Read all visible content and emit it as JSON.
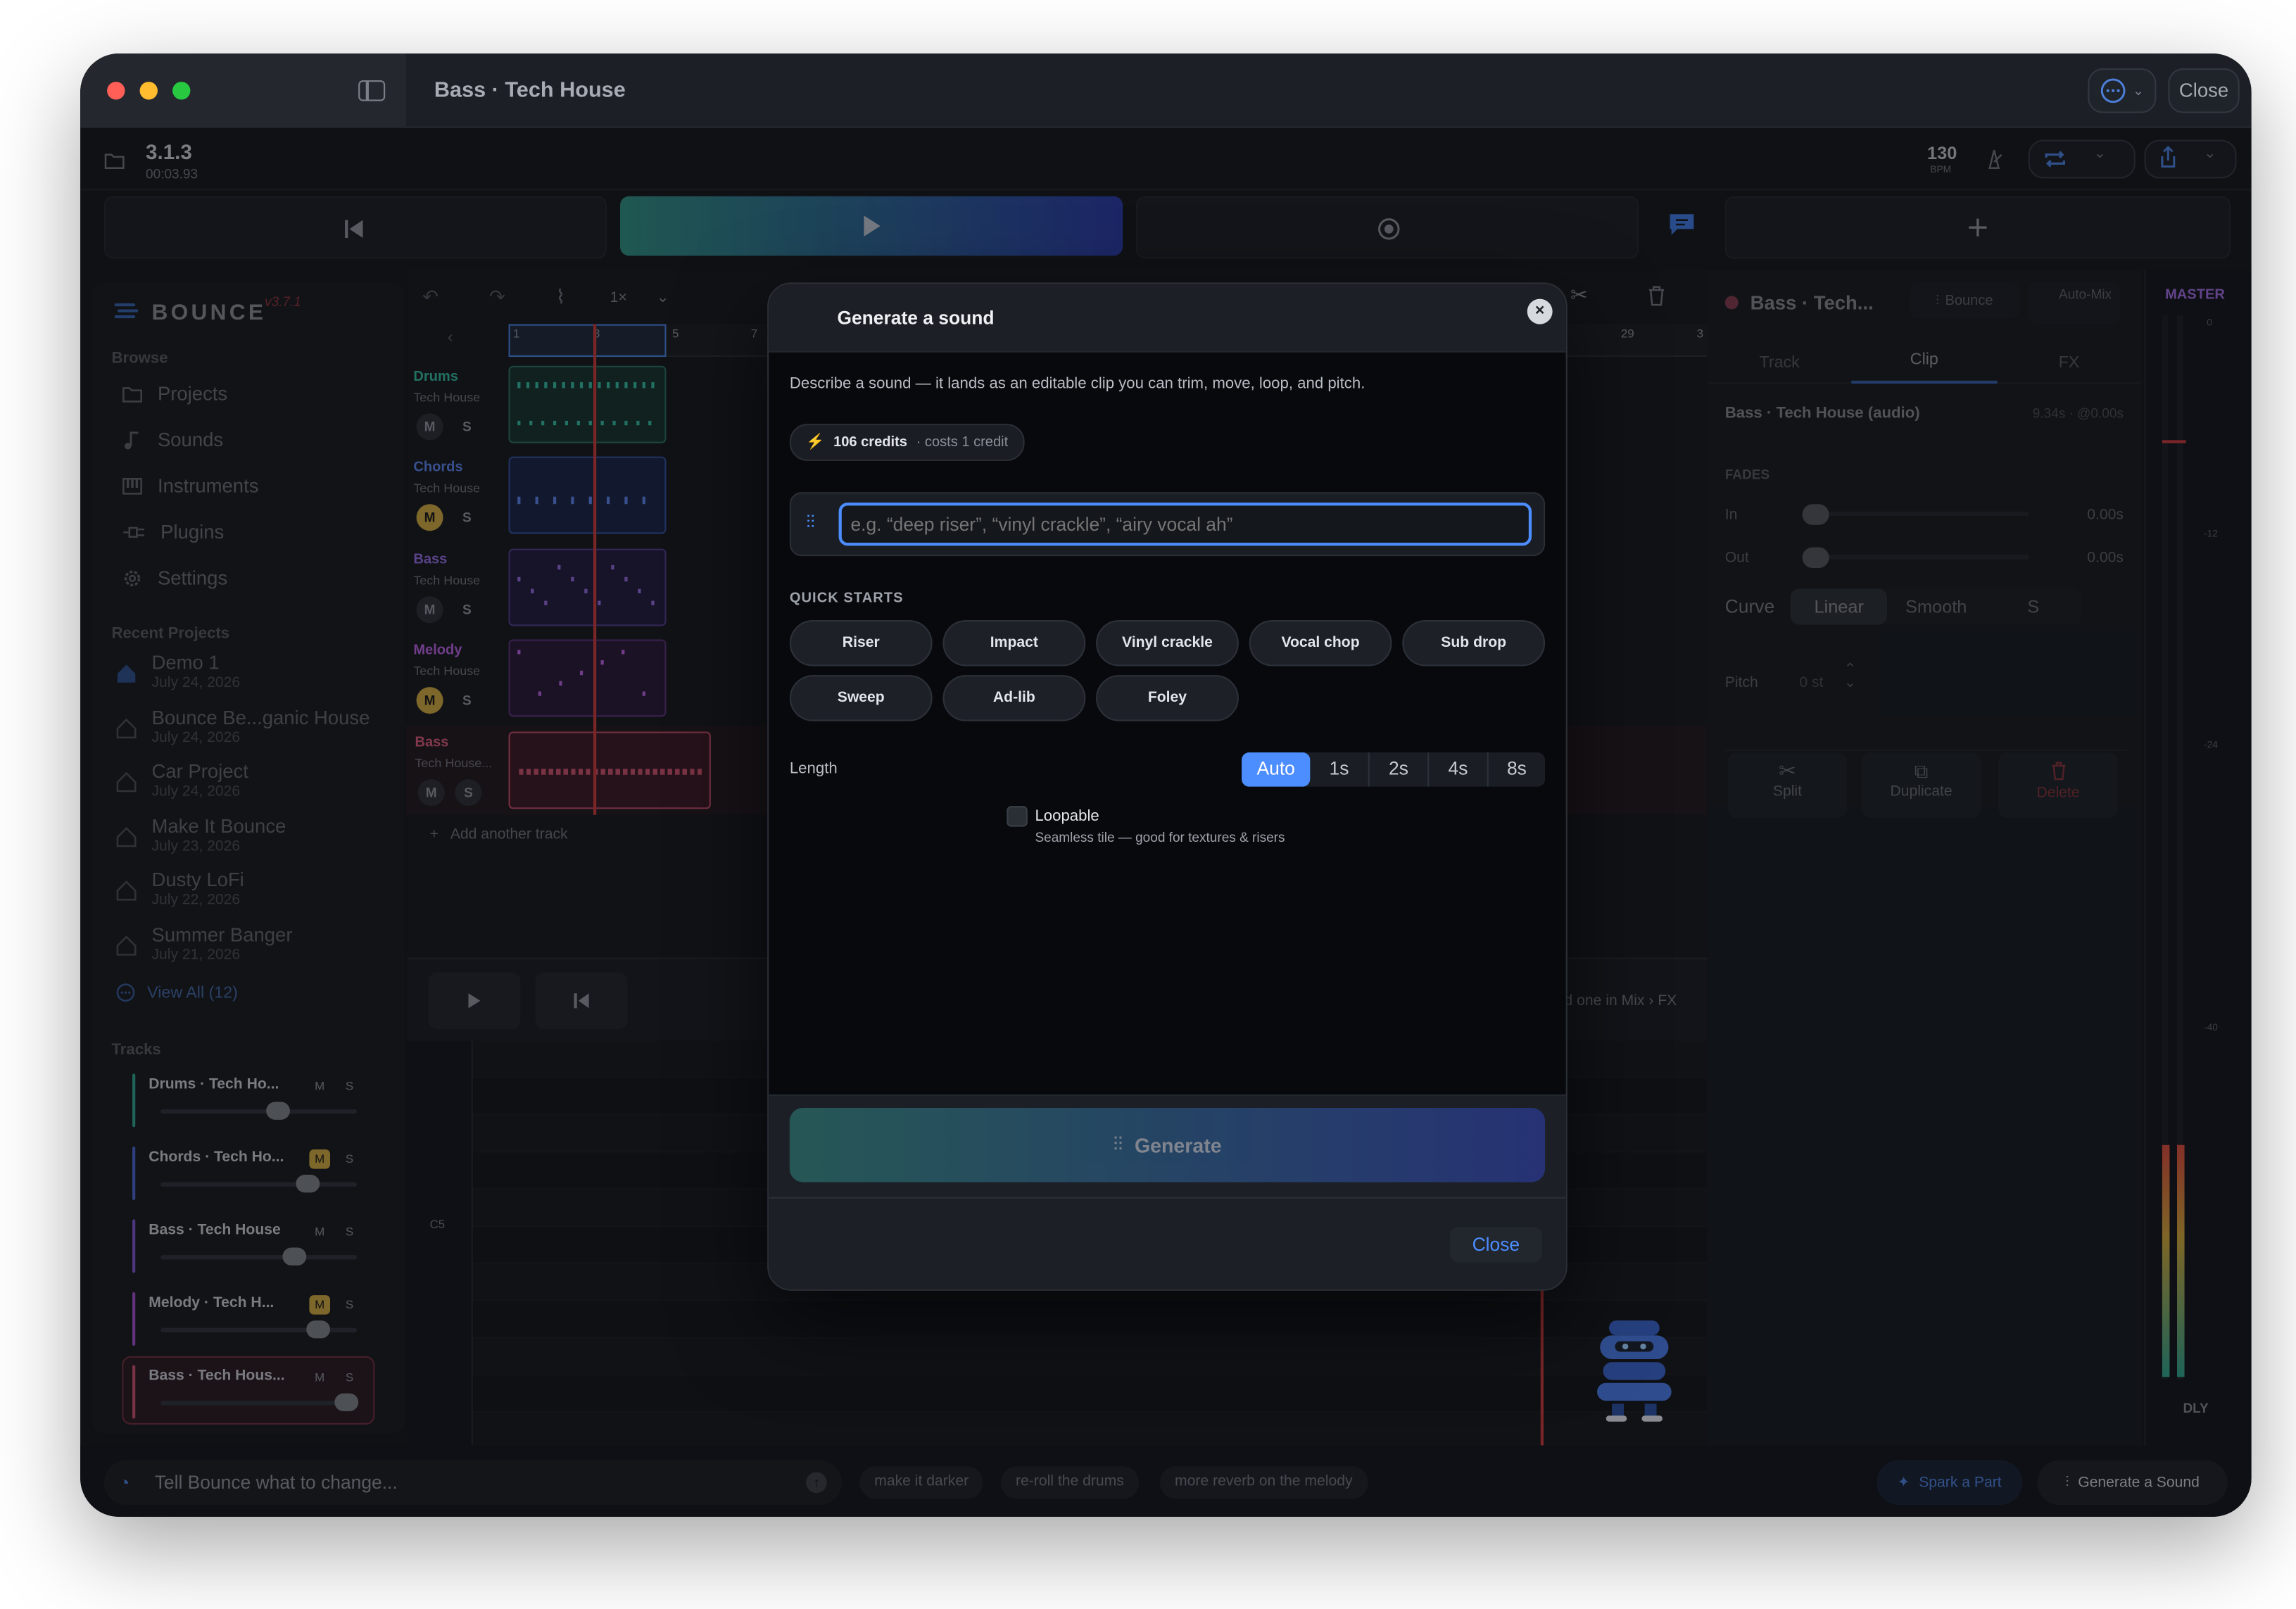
{
  "window": {
    "title": "Bass · Tech House",
    "close_label": "Close"
  },
  "header": {
    "version": "3.1.3",
    "time": "00:03.93",
    "bpm": "130",
    "bpm_unit": "BPM"
  },
  "sidebar": {
    "brand": "BOUNCE",
    "brand_version": "v3.7.1",
    "browse_label": "Browse",
    "nav": [
      "Projects",
      "Sounds",
      "Instruments",
      "Plugins",
      "Settings"
    ],
    "recent_label": "Recent Projects",
    "recent": [
      {
        "title": "Demo 1",
        "date": "July 24, 2026"
      },
      {
        "title": "Bounce Be...ganic House",
        "date": "July 24, 2026"
      },
      {
        "title": "Car Project",
        "date": "July 24, 2026"
      },
      {
        "title": "Make It Bounce",
        "date": "July 23, 2026"
      },
      {
        "title": "Dusty LoFi",
        "date": "July 22, 2026"
      },
      {
        "title": "Summer Banger",
        "date": "July 21, 2026"
      }
    ],
    "view_all": "View All (12)",
    "tracks_label": "Tracks",
    "tracks": [
      {
        "name": "Drums · Tech Ho...",
        "m": "M",
        "s": "S",
        "color": "#2f9e8a",
        "level": 0.6,
        "muted": false
      },
      {
        "name": "Chords · Tech Ho...",
        "m": "M",
        "s": "S",
        "color": "#4a63c8",
        "level": 0.75,
        "muted": true
      },
      {
        "name": "Bass · Tech House",
        "m": "M",
        "s": "S",
        "color": "#7a54c8",
        "level": 0.68,
        "muted": false
      },
      {
        "name": "Melody · Tech H...",
        "m": "M",
        "s": "S",
        "color": "#9b4fc4",
        "level": 0.8,
        "muted": true
      },
      {
        "name": "Bass · Tech Hous...",
        "m": "M",
        "s": "S",
        "color": "#c2506a",
        "level": 0.95,
        "muted": false
      }
    ]
  },
  "toolbar": {
    "speed": "1×"
  },
  "ruler": [
    "1",
    "3",
    "5",
    "7",
    "29",
    "3"
  ],
  "lanes": [
    {
      "name": "Drums",
      "genre": "Tech House",
      "m": "M",
      "s": "S",
      "color": "#35b39b"
    },
    {
      "name": "Chords",
      "genre": "Tech House",
      "m": "M",
      "s": "S",
      "color": "#5a7ee0"
    },
    {
      "name": "Bass",
      "genre": "Tech House",
      "m": "M",
      "s": "S",
      "color": "#8f6ad8"
    },
    {
      "name": "Melody",
      "genre": "Tech House",
      "m": "M",
      "s": "S",
      "color": "#b260d8"
    },
    {
      "name": "Bass",
      "genre": "Tech House...",
      "m": "M",
      "s": "S",
      "color": "#d05a78"
    }
  ],
  "add_track": "Add another track",
  "piano_note": "C5",
  "mix_hint": "d one in Mix › FX",
  "modal": {
    "title": "Generate a sound",
    "description": "Describe a sound — it lands as an editable clip you can trim, move, loop, and pitch.",
    "credits": "106 credits",
    "cost": "· costs 1 credit",
    "placeholder": "e.g. “deep riser”, “vinyl crackle”, “airy vocal ah”",
    "quick_label": "QUICK STARTS",
    "quick_starts": [
      "Riser",
      "Impact",
      "Vinyl crackle",
      "Vocal chop",
      "Sub drop",
      "Sweep",
      "Ad-lib",
      "Foley"
    ],
    "length_label": "Length",
    "lengths": [
      "Auto",
      "1s",
      "2s",
      "4s",
      "8s"
    ],
    "selected_length": "Auto",
    "loopable_label": "Loopable",
    "loopable_hint": "Seamless tile — good for textures & risers",
    "generate_label": "Generate",
    "close_label": "Close"
  },
  "right_panel": {
    "track_title": "Bass · Tech...",
    "bounce": "Bounce",
    "automix": "Auto-Mix",
    "tabs": [
      "Track",
      "Clip",
      "FX"
    ],
    "active_tab": "Clip",
    "clip_name": "Bass · Tech House (audio)",
    "clip_meta": "9.34s · @0.00s",
    "fades_label": "FADES",
    "fade_in": "In",
    "fade_in_val": "0.00s",
    "fade_out": "Out",
    "fade_out_val": "0.00s",
    "curve_label": "Curve",
    "curves": [
      "Linear",
      "Smooth",
      "S"
    ],
    "pitch_label": "Pitch",
    "pitch_val": "0 st",
    "actions": [
      "Split",
      "Duplicate",
      "Delete"
    ]
  },
  "master": {
    "label": "MASTER",
    "ticks": [
      "0",
      "-12",
      "-24",
      "-40"
    ],
    "dly": "DLY",
    "level": 0.6
  },
  "bottom": {
    "prompt_placeholder": "Tell Bounce what to change...",
    "suggestions": [
      "make it darker",
      "re-roll the drums",
      "more reverb on the melody"
    ],
    "spark": "Spark a Part",
    "generate_sound": "Generate a Sound"
  },
  "colors": {
    "accent": "#4c8dff",
    "mute": "#c9a442",
    "gradient_start": "#2f8a7e",
    "gradient_end": "#2a3aa0",
    "playhead": "#c23b3b"
  }
}
